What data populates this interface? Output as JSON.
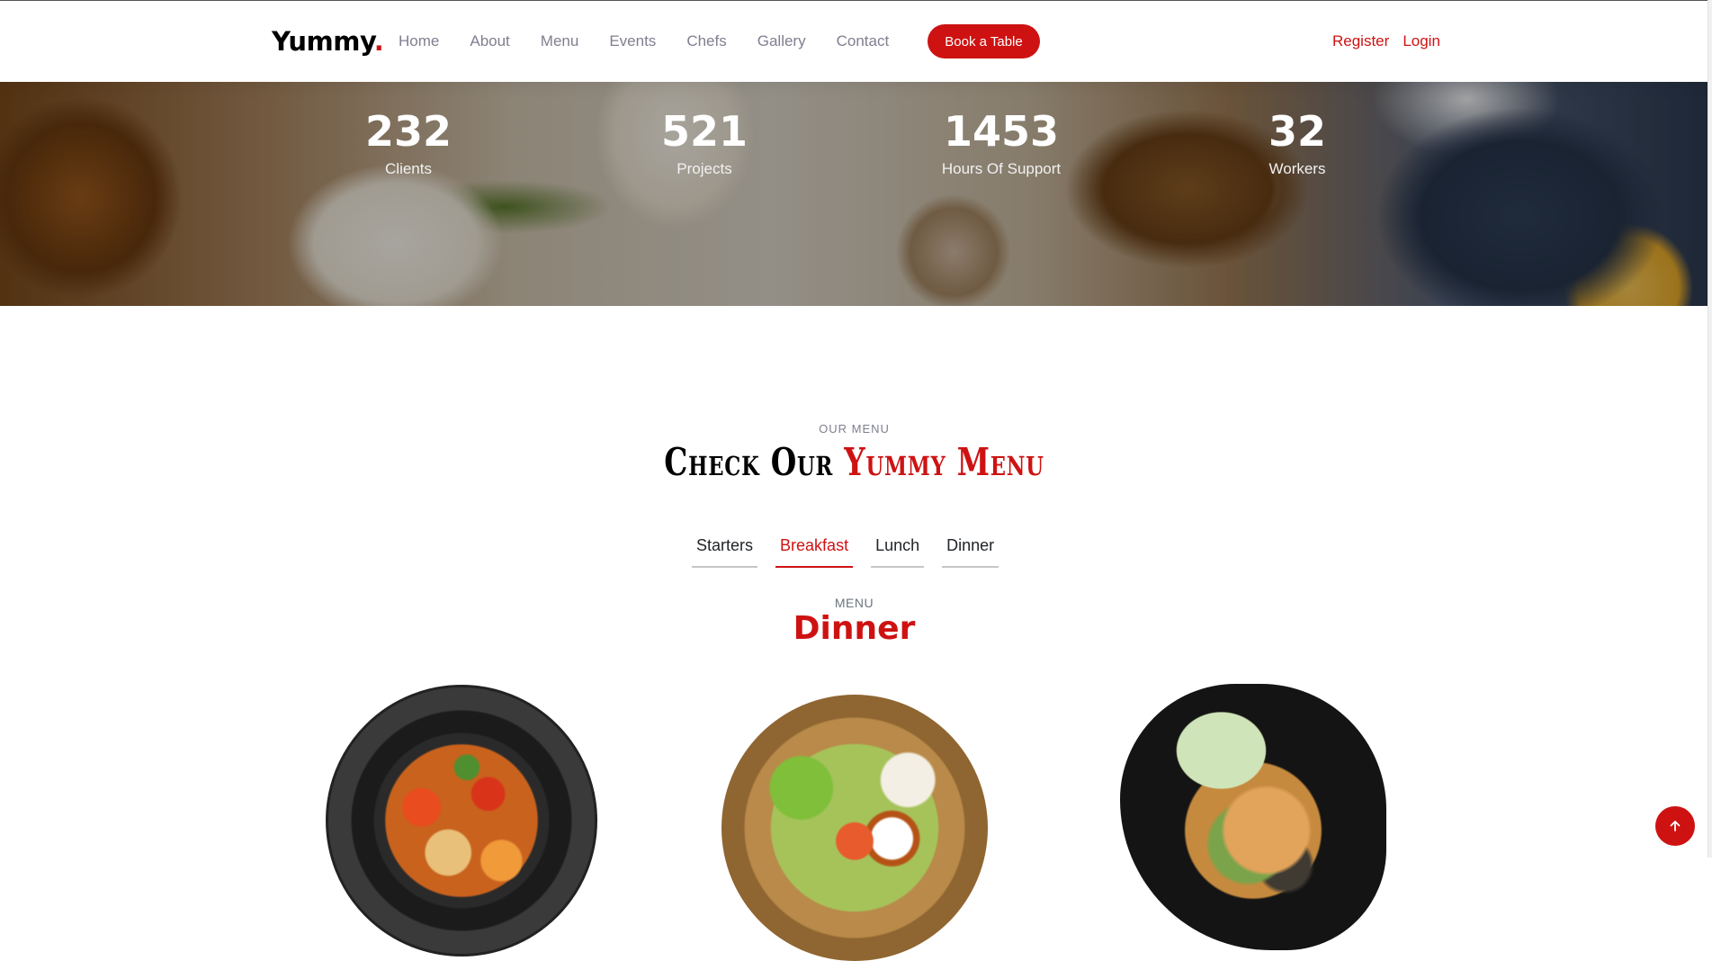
{
  "header": {
    "logo_text": "Yummy",
    "logo_dot": ".",
    "nav": [
      "Home",
      "About",
      "Menu",
      "Events",
      "Chefs",
      "Gallery",
      "Contact"
    ],
    "cta_label": "Book a Table",
    "register_label": "Register",
    "login_label": "Login"
  },
  "stats": [
    {
      "value": "232",
      "label": "Clients"
    },
    {
      "value": "521",
      "label": "Projects"
    },
    {
      "value": "1453",
      "label": "Hours Of Support"
    },
    {
      "value": "32",
      "label": "Workers"
    }
  ],
  "menu_section": {
    "eyebrow": "OUR MENU",
    "title_plain": "Check Our",
    "title_accent": "Yummy Menu",
    "tabs": [
      "Starters",
      "Breakfast",
      "Lunch",
      "Dinner"
    ],
    "active_tab": "Breakfast",
    "label": "MENU",
    "heading": "Dinner"
  },
  "colors": {
    "accent": "#ce1212",
    "nav_text": "#7f7f90"
  },
  "icons": {
    "back_to_top": "arrow-up-icon"
  }
}
